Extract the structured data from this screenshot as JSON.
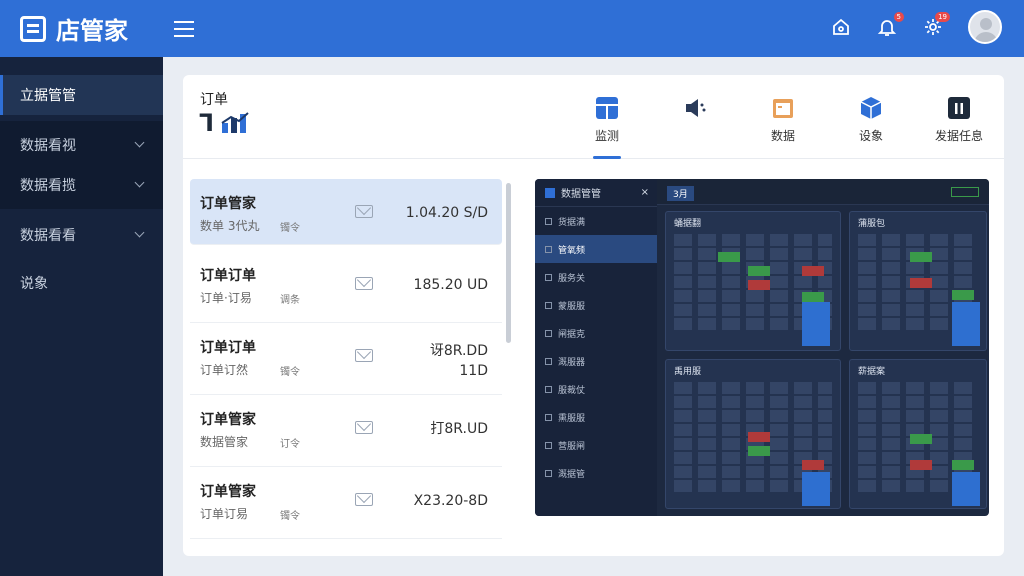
{
  "app": {
    "title": "店管家"
  },
  "topbar": {
    "notif_badge": "5",
    "settings_badge": "19"
  },
  "sidebar": {
    "items": [
      {
        "label": "立据管管"
      },
      {
        "label": "数据看视"
      },
      {
        "label": "数据看揽"
      },
      {
        "label": "数据看看"
      },
      {
        "label": "说象"
      }
    ]
  },
  "header": {
    "title": "订单",
    "glyphs": "ᒣ"
  },
  "tabs": [
    {
      "label": "监测",
      "icon": "grid-icon"
    },
    {
      "label": "",
      "icon": "speaker-icon"
    },
    {
      "label": "数据",
      "icon": "folder-icon"
    },
    {
      "label": "设象",
      "icon": "box-icon"
    },
    {
      "label": "发据任息",
      "icon": "chart-icon"
    }
  ],
  "orders": [
    {
      "title": "订单管家",
      "sub": "数单 3代丸",
      "sub2": "镯令",
      "value": "1.04.20 S/D"
    },
    {
      "title": "订单订单",
      "sub": "订单·订易",
      "sub2": "调条",
      "value": "185.20 UD"
    },
    {
      "title": "订单订单",
      "sub": "订单订然",
      "sub2": "镯令",
      "value": "讶8R.DD\n11D"
    },
    {
      "title": "订单管家",
      "sub": "数据管家",
      "sub2": "订令",
      "value": "打8R.UD"
    },
    {
      "title": "订单管家",
      "sub": "订单订易",
      "sub2": "镯令",
      "value": "X23.20-8D"
    }
  ],
  "preview": {
    "title": "数据管管",
    "tab": "3月",
    "menu": [
      "货据满",
      "管氧频",
      "服务关",
      "蒙服服",
      "闸据克",
      "溉服器",
      "服裁仗",
      "熏服服",
      "营服闸",
      "溉据管"
    ],
    "panels": [
      "蛹据翻",
      "蒲服包",
      "禹用服",
      "薪据案"
    ]
  }
}
